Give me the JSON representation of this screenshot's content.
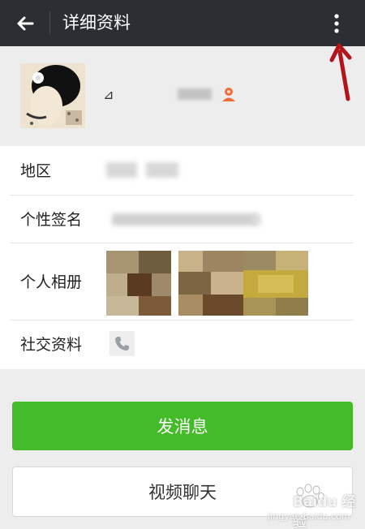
{
  "header": {
    "title": "详细资料",
    "back_icon": "arrow-left-icon",
    "more_icon": "more-vertical-icon"
  },
  "profile": {
    "gender_mark": "⊿",
    "nickname_blurred": "",
    "contact_icon": "person-icon"
  },
  "details": {
    "rows": [
      {
        "label": "地区",
        "value_blurred": ""
      },
      {
        "label": "个性签名",
        "value_blurred": ""
      },
      {
        "label": "个人相册"
      },
      {
        "label": "社交资料",
        "icon": "phone-icon"
      }
    ]
  },
  "actions": {
    "send_message": "发消息",
    "video_chat": "视频聊天"
  },
  "watermark": {
    "text": "Baidu 经验",
    "sub": "jingyan.baidu.com"
  },
  "colors": {
    "topbar": "#2b2f33",
    "accent_green": "#44bb29",
    "annotation_red": "#b3141c",
    "contact_icon_orange": "#f26b3a"
  }
}
